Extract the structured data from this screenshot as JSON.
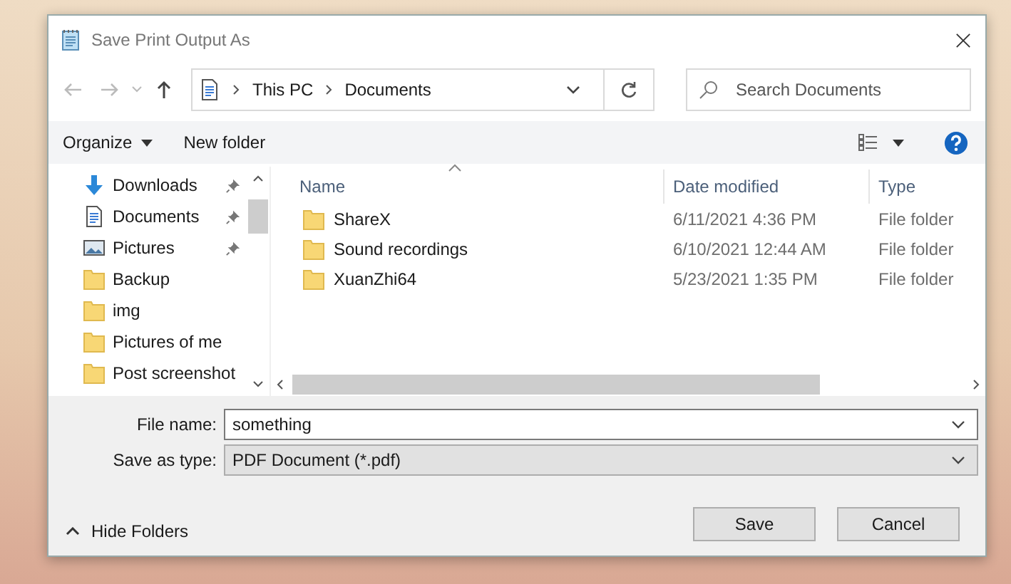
{
  "window": {
    "title": "Save Print Output As"
  },
  "address_bar": {
    "path": [
      {
        "label": "This PC"
      },
      {
        "label": "Documents"
      }
    ]
  },
  "search": {
    "placeholder": "Search Documents"
  },
  "toolbar": {
    "organize": "Organize",
    "new_folder": "New folder"
  },
  "sidebar": {
    "items": [
      {
        "label": "Downloads",
        "kind": "download",
        "pinned": true
      },
      {
        "label": "Documents",
        "kind": "document",
        "pinned": true
      },
      {
        "label": "Pictures",
        "kind": "picture",
        "pinned": true
      },
      {
        "label": "Backup",
        "kind": "folder",
        "pinned": false
      },
      {
        "label": "img",
        "kind": "folder",
        "pinned": false
      },
      {
        "label": "Pictures of me",
        "kind": "folder",
        "pinned": false
      },
      {
        "label": "Post screenshot",
        "kind": "folder",
        "pinned": false
      }
    ]
  },
  "table": {
    "columns": [
      {
        "label": "Name",
        "sorted": true
      },
      {
        "label": "Date modified",
        "sorted": false
      },
      {
        "label": "Type",
        "sorted": false
      }
    ],
    "rows": [
      {
        "name": "ShareX",
        "date": "6/11/2021 4:36 PM",
        "type": "File folder"
      },
      {
        "name": "Sound recordings",
        "date": "6/10/2021 12:44 AM",
        "type": "File folder"
      },
      {
        "name": "XuanZhi64",
        "date": "5/23/2021 1:35 PM",
        "type": "File folder"
      }
    ]
  },
  "file_name": {
    "label": "File name:",
    "value": "something"
  },
  "save_as_type": {
    "label": "Save as type:",
    "value": "PDF Document (*.pdf)"
  },
  "hide_folders": "Hide Folders",
  "buttons": [
    {
      "label": "Save"
    },
    {
      "label": "Cancel"
    }
  ]
}
